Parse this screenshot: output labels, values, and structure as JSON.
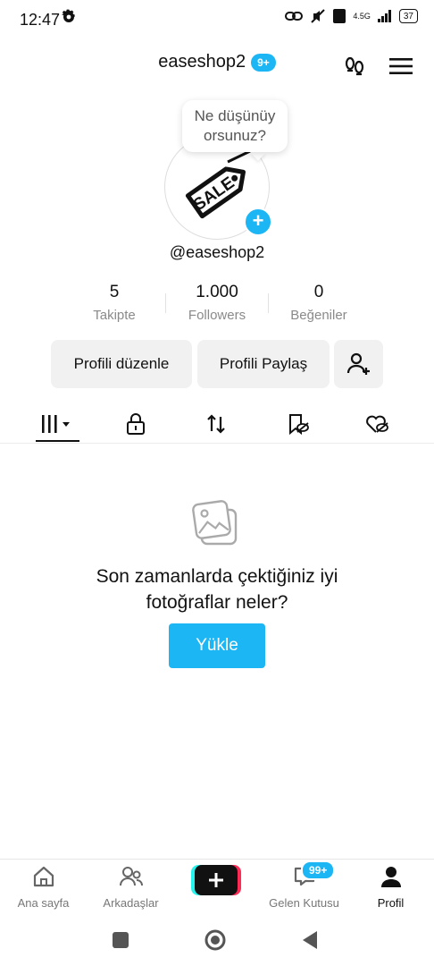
{
  "status": {
    "time": "12:47",
    "network": "4.5G",
    "battery": "37"
  },
  "header": {
    "title": "easeshop2",
    "badge": "9+"
  },
  "bubble": {
    "text_line1": "Ne düşünüy",
    "text_line2": "orsunuz?"
  },
  "avatar": {
    "label": "SALE"
  },
  "profile": {
    "username": "@easeshop2"
  },
  "stats": [
    {
      "value": "5",
      "label": "Takipte"
    },
    {
      "value": "1.000",
      "label": "Followers"
    },
    {
      "value": "0",
      "label": "Beğeniler"
    }
  ],
  "actions": {
    "edit": "Profili düzenle",
    "share": "Profili Paylaş"
  },
  "empty": {
    "line1": "Son zamanlarda çektiğiniz iyi",
    "line2": "fotoğraflar neler?",
    "button": "Yükle"
  },
  "nav": {
    "home": "Ana sayfa",
    "friends": "Arkadaşlar",
    "inbox": "Gelen Kutusu",
    "inbox_badge": "99+",
    "profile": "Profil"
  },
  "colors": {
    "accent": "#1cb6f5",
    "create_left": "#25f4ee",
    "create_right": "#fe2c55"
  }
}
